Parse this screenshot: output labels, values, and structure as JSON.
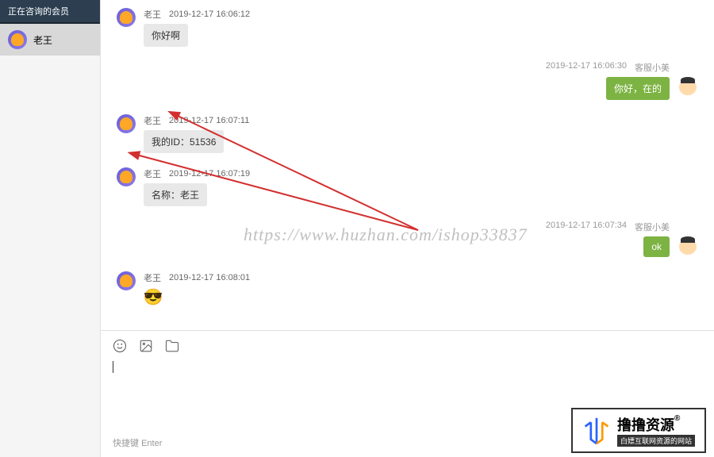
{
  "sidebar": {
    "header": "正在咨询的会员",
    "items": [
      {
        "name": "老王"
      }
    ]
  },
  "messages": [
    {
      "side": "left",
      "name": "老王",
      "time": "2019-12-17 16:06:12",
      "text": "你好啊"
    },
    {
      "side": "right",
      "name": "客服小美",
      "time": "2019-12-17 16:06:30",
      "text": "你好，在的"
    },
    {
      "side": "left",
      "name": "老王",
      "time": "2019-12-17 16:07:11",
      "text": "我的ID：51536"
    },
    {
      "side": "left",
      "name": "老王",
      "time": "2019-12-17 16:07:19",
      "text": "名称：老王"
    },
    {
      "side": "right",
      "name": "客服小美",
      "time": "2019-12-17 16:07:34",
      "text": "ok"
    },
    {
      "side": "left",
      "name": "老王",
      "time": "2019-12-17 16:08:01",
      "emoji": "😎"
    }
  ],
  "watermark": "https://www.huzhan.com/ishop33837",
  "input": {
    "hotkey_label": "快捷键",
    "hotkey_value": "Enter"
  },
  "brand": {
    "main": "撸撸资源",
    "reg": "®",
    "sub": "白嫖互联网资源的网站"
  }
}
